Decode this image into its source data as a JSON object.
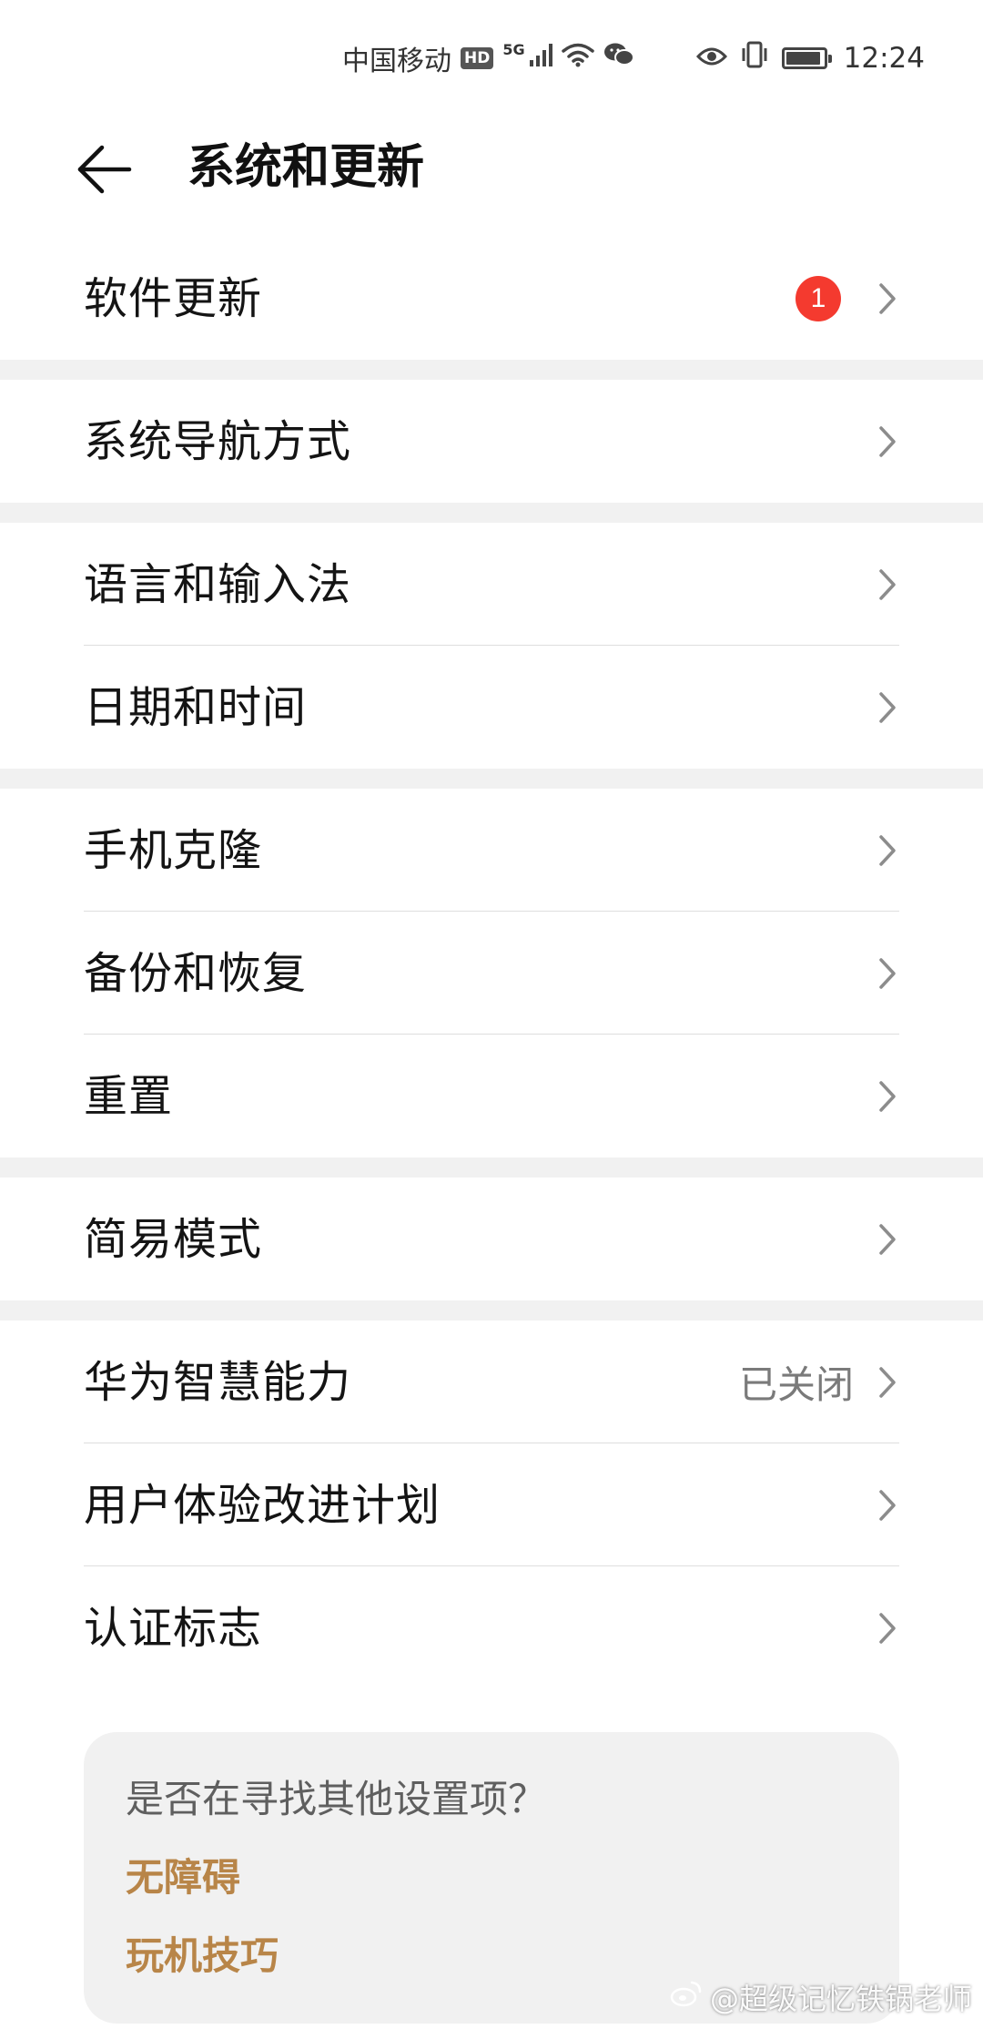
{
  "status_bar": {
    "carrier": "中国移动",
    "hd": "HD",
    "network": "5G",
    "time": "12:24"
  },
  "header": {
    "title": "系统和更新"
  },
  "groups": [
    {
      "items": [
        {
          "label": "软件更新",
          "badge": "1"
        }
      ]
    },
    {
      "items": [
        {
          "label": "系统导航方式"
        }
      ]
    },
    {
      "items": [
        {
          "label": "语言和输入法"
        },
        {
          "label": "日期和时间"
        }
      ]
    },
    {
      "items": [
        {
          "label": "手机克隆"
        },
        {
          "label": "备份和恢复"
        },
        {
          "label": "重置"
        }
      ]
    },
    {
      "items": [
        {
          "label": "简易模式"
        }
      ]
    },
    {
      "items": [
        {
          "label": "华为智慧能力",
          "value": "已关闭"
        },
        {
          "label": "用户体验改进计划"
        },
        {
          "label": "认证标志"
        }
      ]
    }
  ],
  "suggestions": {
    "question": "是否在寻找其他设置项？",
    "links": [
      "无障碍",
      "玩机技巧"
    ]
  },
  "watermark": "@超级记忆铁锅老师",
  "colors": {
    "badge": "#f43a2f",
    "link": "#b88548",
    "separator": "#f1f1f1"
  },
  "icons": [
    "back-arrow-icon",
    "chevron-right-icon",
    "eye-icon",
    "vibrate-icon",
    "battery-icon",
    "wifi-icon",
    "signal-icon",
    "wechat-icon",
    "weibo-icon"
  ]
}
